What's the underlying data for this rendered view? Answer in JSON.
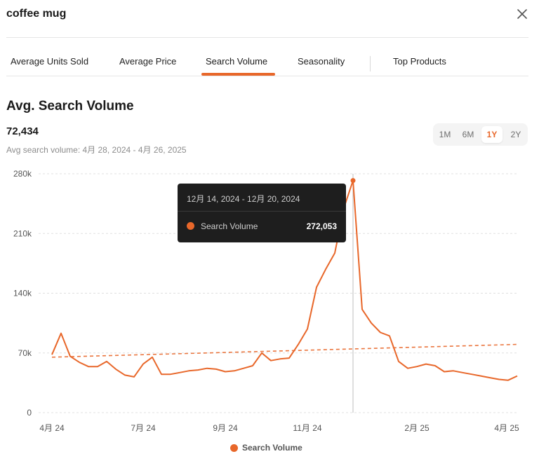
{
  "header": {
    "title": "coffee mug"
  },
  "tabs": [
    {
      "label": "Average Units Sold"
    },
    {
      "label": "Average Price"
    },
    {
      "label": "Search Volume",
      "active": true
    },
    {
      "label": "Seasonality"
    },
    {
      "label": "Top Products"
    }
  ],
  "summary": {
    "title": "Avg. Search Volume",
    "value": "72,434",
    "subtitle": "Avg search volume: 4月 28, 2024 - 4月 26, 2025"
  },
  "range": {
    "options": [
      "1M",
      "6M",
      "1Y",
      "2Y"
    ],
    "selected": "1Y"
  },
  "tooltip": {
    "title": "12月 14, 2024 - 12月 20, 2024",
    "series": "Search Volume",
    "value": "272,053"
  },
  "legend": {
    "label": "Search Volume"
  },
  "colors": {
    "accent": "#e8672a",
    "trend": "#e8672a",
    "grid": "#e0e0e0",
    "cursor": "#bdbdbd"
  },
  "chart_data": {
    "type": "line",
    "x_unit": "weekly, week starting",
    "x": [
      "2024-04-28",
      "2024-05-05",
      "2024-05-12",
      "2024-05-19",
      "2024-05-26",
      "2024-06-02",
      "2024-06-09",
      "2024-06-16",
      "2024-06-23",
      "2024-06-30",
      "2024-07-07",
      "2024-07-14",
      "2024-07-21",
      "2024-07-28",
      "2024-08-04",
      "2024-08-11",
      "2024-08-18",
      "2024-08-25",
      "2024-09-01",
      "2024-09-08",
      "2024-09-15",
      "2024-09-22",
      "2024-09-29",
      "2024-10-06",
      "2024-10-13",
      "2024-10-20",
      "2024-10-27",
      "2024-11-03",
      "2024-11-10",
      "2024-11-17",
      "2024-11-24",
      "2024-12-01",
      "2024-12-08",
      "2024-12-15",
      "2024-12-22",
      "2024-12-29",
      "2025-01-05",
      "2025-01-12",
      "2025-01-19",
      "2025-01-26",
      "2025-02-02",
      "2025-02-09",
      "2025-02-16",
      "2025-02-23",
      "2025-03-02",
      "2025-03-09",
      "2025-03-16",
      "2025-03-23",
      "2025-03-30",
      "2025-04-06",
      "2025-04-13",
      "2025-04-20"
    ],
    "series": [
      {
        "name": "Search Volume",
        "values": [
          68000,
          93000,
          66000,
          59000,
          54000,
          54000,
          60000,
          51000,
          44000,
          42000,
          57000,
          65000,
          45000,
          45000,
          47000,
          49000,
          50000,
          52000,
          51000,
          48000,
          49000,
          52000,
          55000,
          70000,
          61000,
          63000,
          64000,
          80000,
          98000,
          147000,
          168000,
          187000,
          240000,
          272053,
          121000,
          105000,
          94000,
          90000,
          60000,
          52000,
          54000,
          57000,
          55000,
          48000,
          49000,
          47000,
          45000,
          43000,
          41000,
          39000,
          38000,
          43000
        ]
      },
      {
        "name": "Trend",
        "style": "dashed",
        "values_start_end": [
          65000,
          80000
        ]
      }
    ],
    "x_ticks": [
      "4月 24",
      "7月 24",
      "9月 24",
      "11月 24",
      "2月 25",
      "4月 25"
    ],
    "y_ticks": [
      "0",
      "70k",
      "140k",
      "210k",
      "280k"
    ],
    "ylim": [
      0,
      280000
    ],
    "grid": true,
    "legend_position": "bottom",
    "highlighted_point": "2024-12-15"
  }
}
